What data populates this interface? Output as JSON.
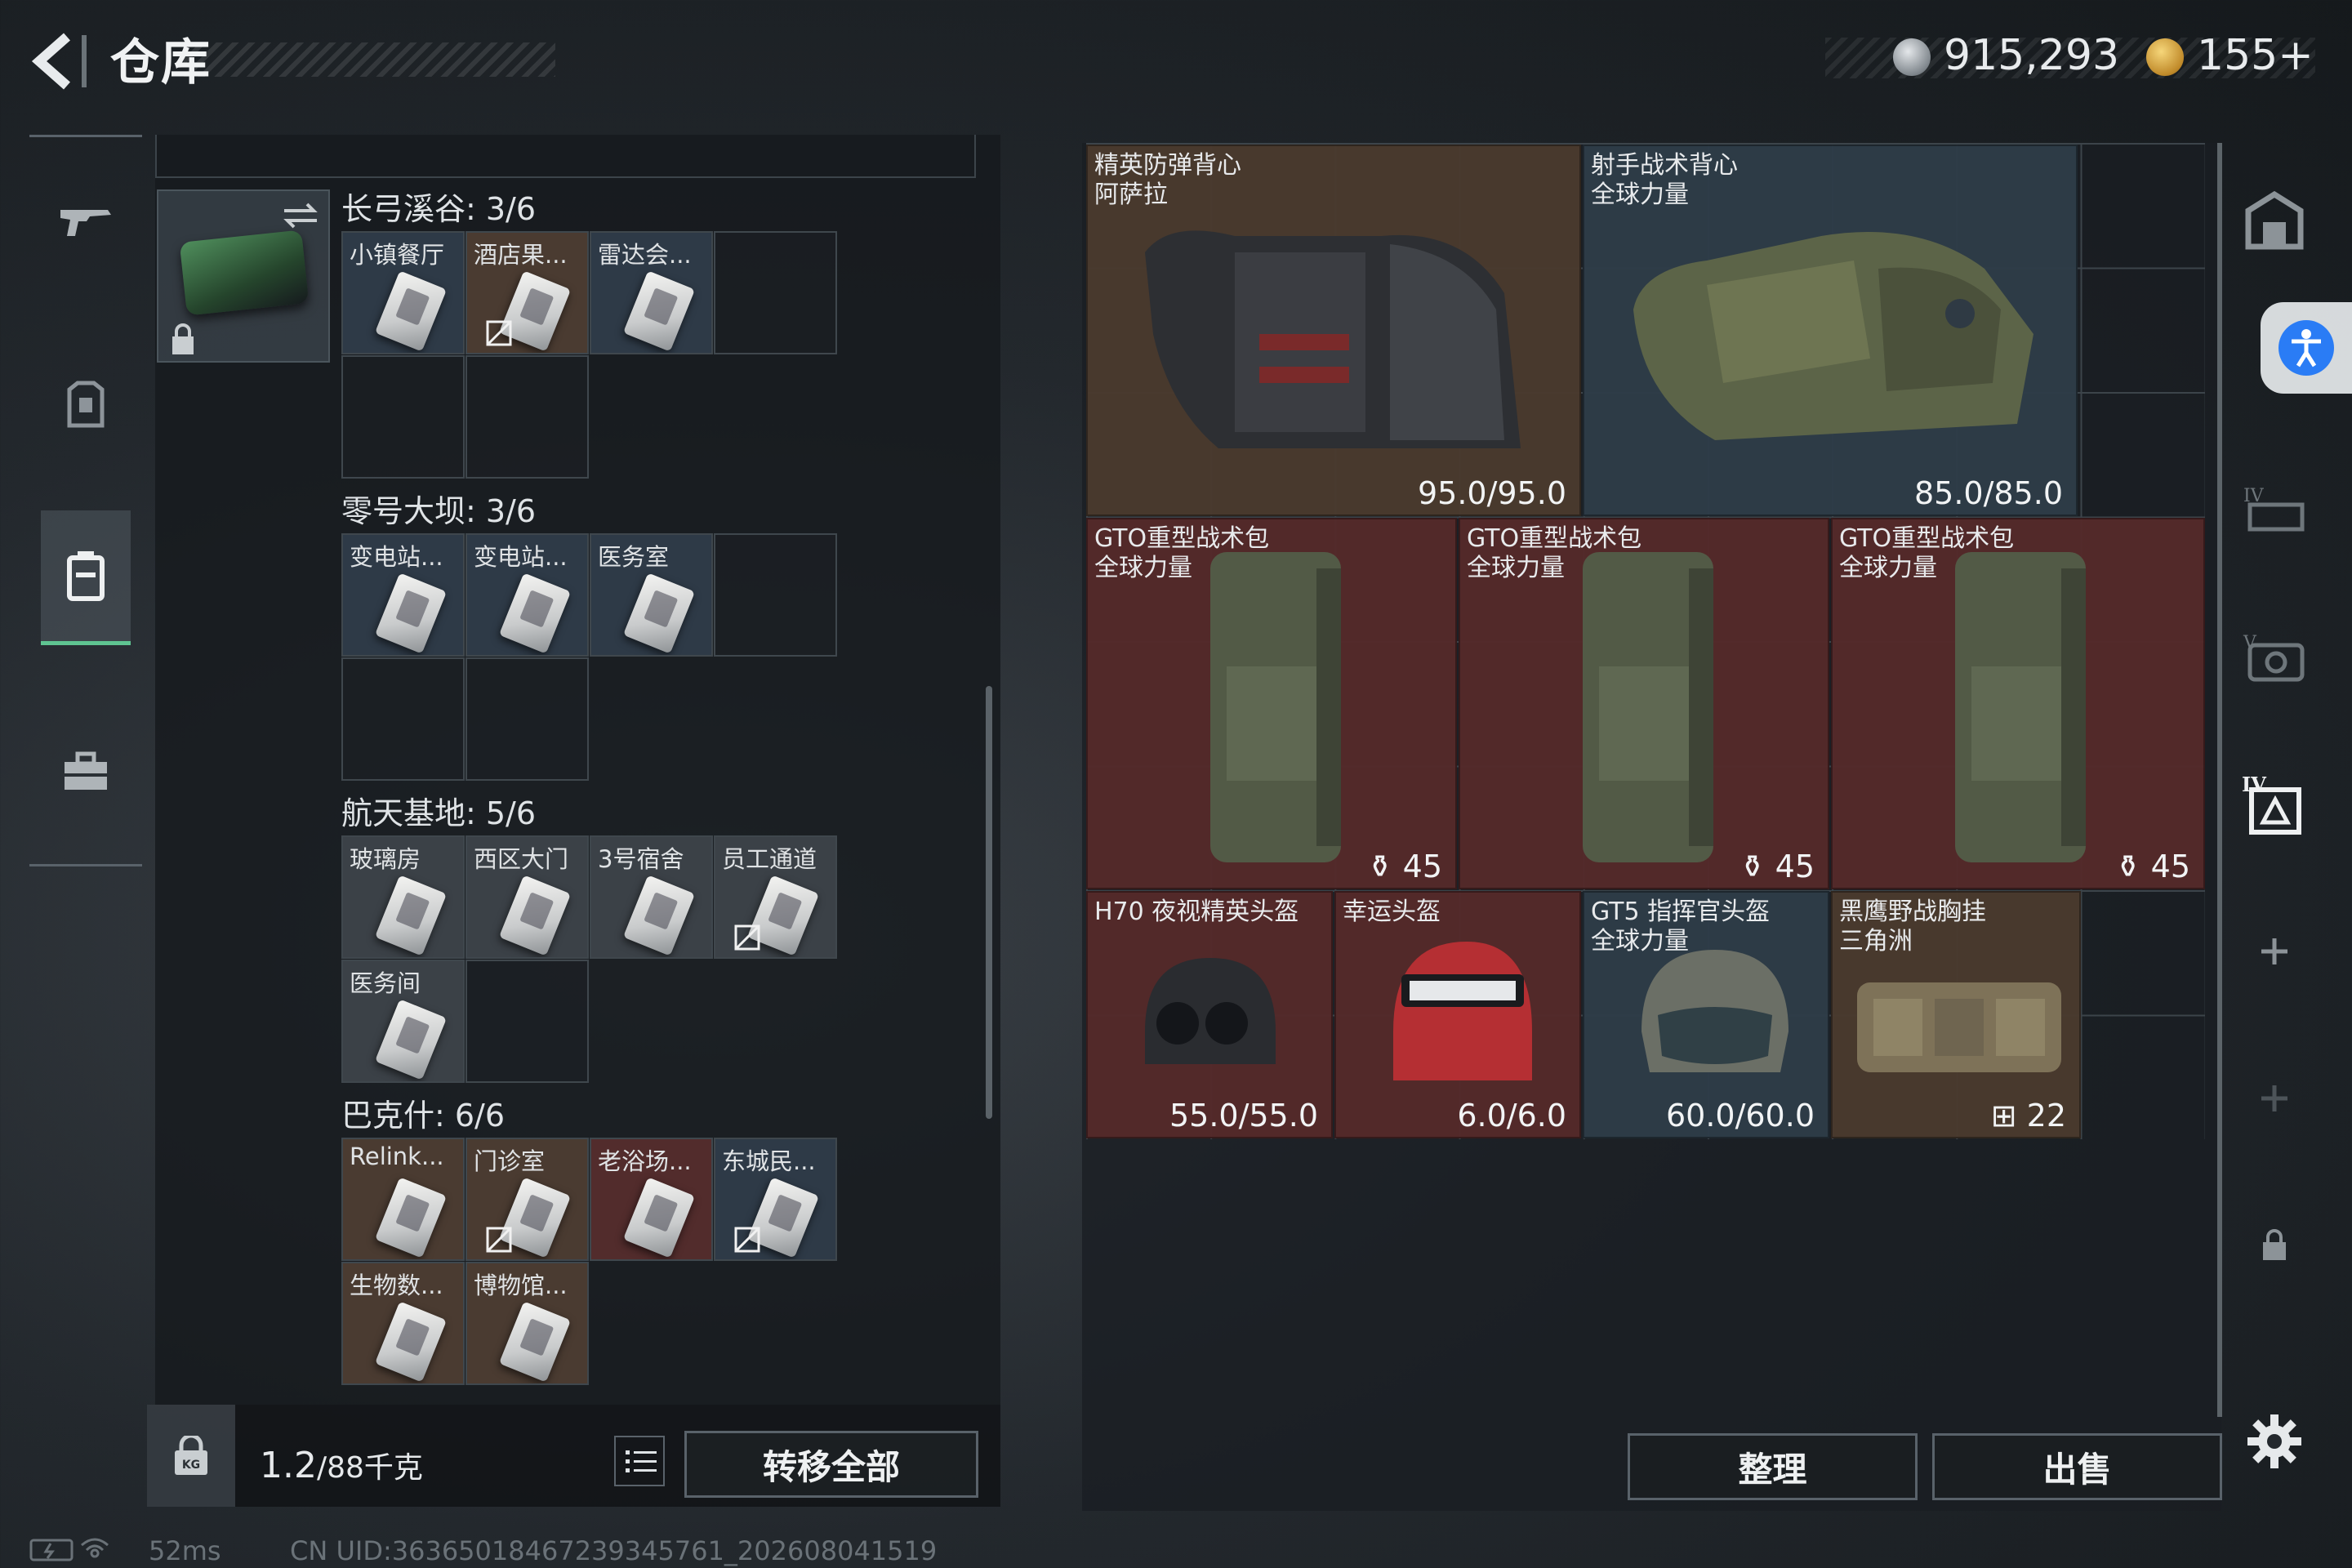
{
  "header": {
    "title": "仓库",
    "money": "915,293",
    "gems": "155+"
  },
  "groups": [
    {
      "title": "长弓溪谷: 3/6",
      "items": [
        "小镇餐厅",
        "酒店果...",
        "雷达会..."
      ]
    },
    {
      "title": "零号大坝: 3/6",
      "items": [
        "变电站...",
        "变电站...",
        "医务室"
      ]
    },
    {
      "title": "航天基地: 5/6",
      "items": [
        "玻璃房",
        "西区大门",
        "3号宿舍",
        "员工通道",
        "医务间"
      ]
    },
    {
      "title": "巴克什: 6/6",
      "items": [
        "Relink...",
        "门诊室",
        "老浴场...",
        "东城民...",
        "生物数...",
        "博物馆..."
      ]
    }
  ],
  "weight": {
    "current": "1.2",
    "max": "/88千克"
  },
  "buttons": {
    "transfer_all": "转移全部",
    "sort": "整理",
    "sell": "出售"
  },
  "stash": [
    {
      "name": "精英防弹背心\n阿萨拉",
      "value": "95.0/95.0"
    },
    {
      "name": "射手战术背心\n全球力量",
      "value": "85.0/85.0"
    },
    {
      "name": "GTO重型战术包\n全球力量",
      "value": "45"
    },
    {
      "name": "GTO重型战术包\n全球力量",
      "value": "45"
    },
    {
      "name": "GTO重型战术包\n全球力量",
      "value": "45"
    },
    {
      "name": "H70 夜视精英头盔",
      "value": "55.0/55.0"
    },
    {
      "name": "幸运头盔",
      "value": "6.0/6.0"
    },
    {
      "name": "GT5 指挥官头盔\n全球力量",
      "value": "60.0/60.0"
    },
    {
      "name": "黑鹰野战胸挂\n三角洲",
      "value": "22"
    }
  ],
  "status": {
    "ping": "52ms",
    "uid": "CN UID:3636501846723934576​1_202608041519"
  },
  "colors": {
    "accent_green": "#5fc491",
    "rarity_red": "#542a2a",
    "rarity_brown": "#4a3a2e",
    "rarity_blue": "#2e3c48"
  },
  "icons": [
    "back-arrow-icon",
    "rifle-icon",
    "armor-icon",
    "backpack-icon",
    "toolbox-icon",
    "swap-icon",
    "lock-icon",
    "kg-lock-icon",
    "list-icon",
    "settings-icon",
    "accessibility-icon"
  ]
}
